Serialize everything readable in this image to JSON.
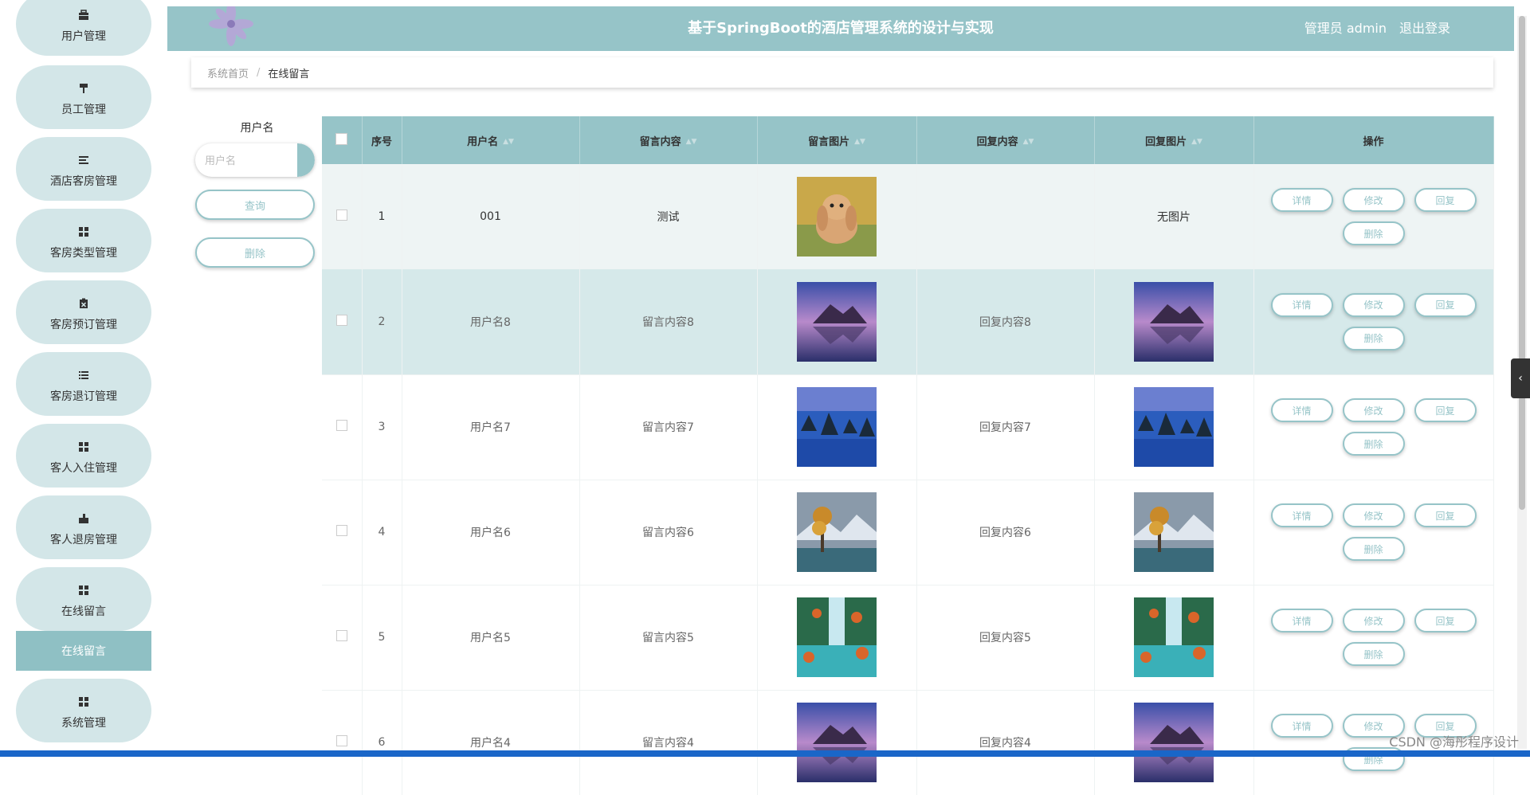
{
  "sidebar": {
    "items": [
      {
        "label": "用户管理",
        "icon": "briefcase-icon"
      },
      {
        "label": "员工管理",
        "icon": "paint-roller-icon"
      },
      {
        "label": "酒店客房管理",
        "icon": "list-icon"
      },
      {
        "label": "客房类型管理",
        "icon": "grid-icon"
      },
      {
        "label": "客房预订管理",
        "icon": "clipboard-icon"
      },
      {
        "label": "客房退订管理",
        "icon": "list-ordered-icon"
      },
      {
        "label": "客人入住管理",
        "icon": "grid-icon"
      },
      {
        "label": "客人退房管理",
        "icon": "hand-icon"
      },
      {
        "label": "在线留言",
        "icon": "grid-icon"
      },
      {
        "label": "系统管理",
        "icon": "grid-icon"
      }
    ],
    "submenu_active": "在线留言"
  },
  "header": {
    "title": "基于SpringBoot的酒店管理系统的设计与实现",
    "user": "管理员 admin",
    "logout": "退出登录"
  },
  "breadcrumb": {
    "home": "系统首页",
    "separator": "/",
    "current": "在线留言"
  },
  "search": {
    "label": "用户名",
    "placeholder": "用户名",
    "query_label": "查询",
    "delete_label": "删除"
  },
  "table": {
    "columns": [
      "序号",
      "用户名",
      "留言内容",
      "留言图片",
      "回复内容",
      "回复图片",
      "操作"
    ],
    "ops": {
      "detail": "详情",
      "edit": "修改",
      "reply": "回复",
      "delete": "删除"
    },
    "rows": [
      {
        "index": "1",
        "username": "001",
        "content": "测试",
        "image": "rabbit",
        "reply": "",
        "reply_image": "",
        "no_image_text": "无图片"
      },
      {
        "index": "2",
        "username": "用户名8",
        "content": "留言内容8",
        "image": "mountain-lake",
        "reply": "回复内容8",
        "reply_image": "mountain-lake"
      },
      {
        "index": "3",
        "username": "用户名7",
        "content": "留言内容7",
        "image": "rocky-sea",
        "reply": "回复内容7",
        "reply_image": "rocky-sea"
      },
      {
        "index": "4",
        "username": "用户名6",
        "content": "留言内容6",
        "image": "autumn-tree",
        "reply": "回复内容6",
        "reply_image": "autumn-tree"
      },
      {
        "index": "5",
        "username": "用户名5",
        "content": "留言内容5",
        "image": "waterfall",
        "reply": "回复内容5",
        "reply_image": "waterfall"
      },
      {
        "index": "6",
        "username": "用户名4",
        "content": "留言内容4",
        "image": "mountain-lake",
        "reply": "回复内容4",
        "reply_image": "mountain-lake"
      }
    ]
  },
  "watermark": "CSDN @海彤程序设计",
  "colors": {
    "accent": "#96c4c8",
    "sidebar_item": "#d3e6e8",
    "sub_active": "#8fc0c4"
  }
}
